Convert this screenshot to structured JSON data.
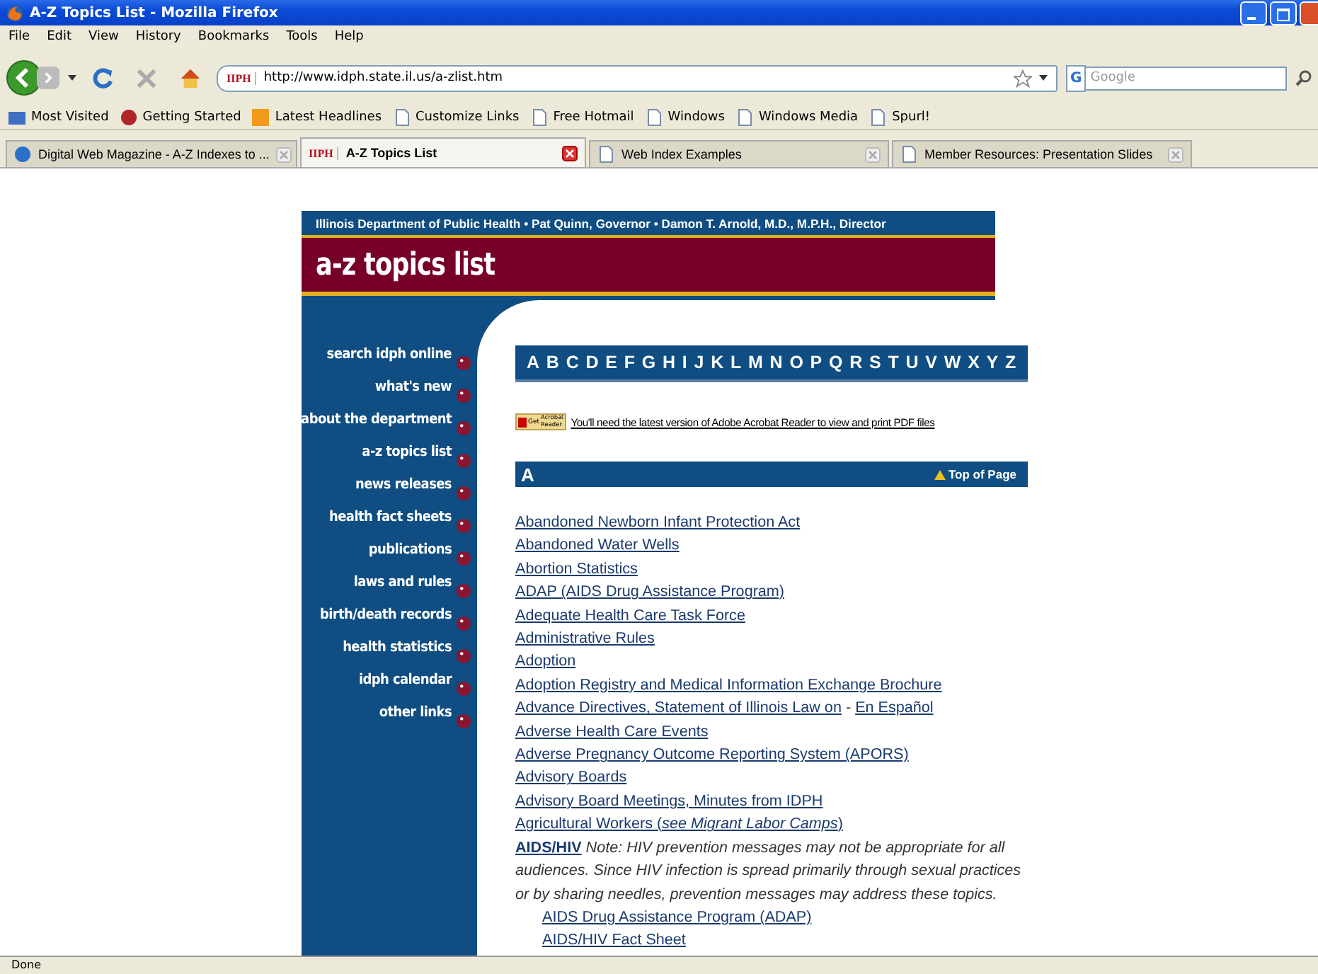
{
  "window": {
    "title": "A-Z Topics List - Mozilla Firefox"
  },
  "menu": [
    "File",
    "Edit",
    "View",
    "History",
    "Bookmarks",
    "Tools",
    "Help"
  ],
  "address": {
    "value": "http://www.idph.state.il.us/a-zlist.htm",
    "site_badge": "IIPH"
  },
  "search": {
    "engine_badge": "G",
    "placeholder": "Google"
  },
  "bookmarks": [
    {
      "label": "Most Visited",
      "kind": "folder"
    },
    {
      "label": "Getting Started",
      "kind": "firefox"
    },
    {
      "label": "Latest Headlines",
      "kind": "feed"
    },
    {
      "label": "Customize Links",
      "kind": "page"
    },
    {
      "label": "Free Hotmail",
      "kind": "page"
    },
    {
      "label": "Windows",
      "kind": "page"
    },
    {
      "label": "Windows Media",
      "kind": "page"
    },
    {
      "label": "Spurl!",
      "kind": "page"
    }
  ],
  "tabs": [
    {
      "label": "Digital Web Magazine - A-Z Indexes to ...",
      "kind": "dw",
      "selected": false
    },
    {
      "label": "A-Z Topics List",
      "kind": "idph",
      "badge": "IIPH",
      "selected": true
    },
    {
      "label": "Web Index Examples",
      "kind": "page",
      "selected": false
    },
    {
      "label": "Member Resources: Presentation Slides",
      "kind": "page",
      "selected": false
    }
  ],
  "page": {
    "header_line": "Illinois Department of Public Health  •  Pat Quinn, Governor  •  Damon T. Arnold, M.D., M.P.H., Director",
    "title": "a-z topics list",
    "nav": [
      "search idph online",
      "what's new",
      "about the department",
      "a-z topics list",
      "news releases",
      "health fact sheets",
      "publications",
      "laws and rules",
      "birth/death records",
      "health statistics",
      "idph calendar",
      "other links"
    ],
    "letters": [
      "A",
      "B",
      "C",
      "D",
      "E",
      "F",
      "G",
      "H",
      "I",
      "J",
      "K",
      "L",
      "M",
      "N",
      "O",
      "P",
      "Q",
      "R",
      "S",
      "T",
      "U",
      "V",
      "W",
      "X",
      "Y",
      "Z"
    ],
    "acrobat": {
      "badge_top": "Acrobat",
      "badge_bottom": "Reader",
      "badge_prefix": "Get",
      "text": "You'll need the latest version of Adobe Acrobat Reader to view and print PDF files"
    },
    "section": {
      "letter": "A",
      "top_link": "Top of Page"
    },
    "entries": [
      {
        "kind": "link",
        "text": "Abandoned Newborn Infant Protection Act"
      },
      {
        "kind": "link",
        "text": "Abandoned Water Wells"
      },
      {
        "kind": "link",
        "text": "Abortion Statistics"
      },
      {
        "kind": "link",
        "text": "ADAP (AIDS Drug Assistance Program)"
      },
      {
        "kind": "link",
        "text": "Adequate Health Care Task Force"
      },
      {
        "kind": "link",
        "text": "Administrative Rules"
      },
      {
        "kind": "link",
        "text": "Adoption"
      },
      {
        "kind": "link",
        "text": "Adoption Registry and Medical Information Exchange Brochure"
      },
      {
        "kind": "pair",
        "text": "Advance Directives, Statement of Illinois Law on",
        "separator": "-",
        "text2": "En Español"
      },
      {
        "kind": "link",
        "text": "Adverse Health Care Events"
      },
      {
        "kind": "link",
        "text": "Adverse Pregnancy Outcome Reporting System (APORS)"
      },
      {
        "kind": "link",
        "text": "Advisory Boards"
      },
      {
        "kind": "link",
        "text": "Advisory Board Meetings, Minutes from IDPH"
      },
      {
        "kind": "link",
        "text": "Agricultural Workers (*see Migrant Labor Camps*)"
      },
      {
        "kind": "note",
        "text": "AIDS/HIV",
        "note": "Note: HIV prevention messages may not be appropriate for all audiences. Since HIV infection is spread primarily through sexual practices or by sharing needles, prevention messages may address these topics.",
        "children": [
          {
            "kind": "link",
            "text": "AIDS Drug Assistance Program (ADAP)"
          },
          {
            "kind": "link",
            "text": "AIDS/HIV Fact Sheet"
          }
        ]
      }
    ]
  },
  "status_bar": "Done"
}
